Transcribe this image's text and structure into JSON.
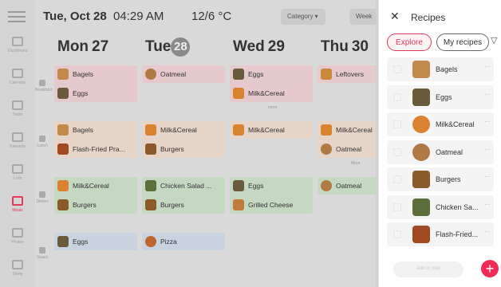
{
  "header": {
    "date": "Tue, Oct 28",
    "time": "04:29 AM",
    "weather": "12/6 °C",
    "category_label": "Category ▾",
    "week_label": "Week"
  },
  "rail": [
    {
      "icon": "dashboard-icon",
      "label": "Dashboard",
      "active": false
    },
    {
      "icon": "calendar-icon",
      "label": "Calendar",
      "active": false
    },
    {
      "icon": "tasks-icon",
      "label": "Tasks",
      "active": false
    },
    {
      "icon": "rewards-icon",
      "label": "Rewards",
      "active": false
    },
    {
      "icon": "lists-icon",
      "label": "Lists",
      "active": false
    },
    {
      "icon": "meals-icon",
      "label": "Meals",
      "active": true
    },
    {
      "icon": "photos-icon",
      "label": "Photos",
      "active": false
    },
    {
      "icon": "sleep-icon",
      "label": "Sleep",
      "active": false
    }
  ],
  "days": [
    {
      "name": "Mon",
      "num": "27",
      "today": false
    },
    {
      "name": "Tue",
      "num": "28",
      "today": true
    },
    {
      "name": "Wed",
      "num": "29",
      "today": false
    },
    {
      "name": "Thu",
      "num": "30",
      "today": false
    }
  ],
  "meal_bands": [
    {
      "label": "Breakfast",
      "color": "#e6c9cd",
      "cells": [
        [
          {
            "name": "Bagels",
            "thumb": "#c28a4a"
          },
          {
            "name": "Eggs",
            "thumb": "#6a5a3c"
          }
        ],
        [
          {
            "name": "Oatmeal",
            "thumb": "#b07a45"
          }
        ],
        [
          {
            "name": "Eggs",
            "thumb": "#6a5a3c"
          },
          {
            "name": "Milk&Cereal",
            "thumb": "#d9822f"
          }
        ],
        [
          {
            "name": "Leftovers",
            "thumb": "#c9893a"
          }
        ]
      ],
      "more": "more"
    },
    {
      "label": "Lunch",
      "color": "#e6d4c6",
      "cells": [
        [
          {
            "name": "Bagels",
            "thumb": "#c28a4a"
          },
          {
            "name": "Flash-Fried Pra...",
            "thumb": "#a14a22"
          }
        ],
        [
          {
            "name": "Milk&Cereal",
            "thumb": "#d9822f"
          },
          {
            "name": "Burgers",
            "thumb": "#8a5a2a"
          }
        ],
        [
          {
            "name": "Milk&Cereal",
            "thumb": "#d9822f"
          }
        ],
        [
          {
            "name": "Milk&Cereal",
            "thumb": "#d9822f"
          },
          {
            "name": "Oatmeal",
            "thumb": "#b07a45"
          }
        ]
      ],
      "more": "More"
    },
    {
      "label": "Dinner",
      "color": "#c5d9c2",
      "cells": [
        [
          {
            "name": "Milk&Cereal",
            "thumb": "#d9822f"
          },
          {
            "name": "Burgers",
            "thumb": "#8a5a2a"
          }
        ],
        [
          {
            "name": "Chicken Salad ...",
            "thumb": "#5c6e3a"
          },
          {
            "name": "Burgers",
            "thumb": "#8a5a2a"
          }
        ],
        [
          {
            "name": "Eggs",
            "thumb": "#6a5a3c"
          },
          {
            "name": "Grilled Cheese",
            "thumb": "#c07a3a"
          }
        ],
        [
          {
            "name": "Oatmeal",
            "thumb": "#b07a45"
          }
        ]
      ],
      "more": ""
    },
    {
      "label": "Snack",
      "color": "#c9d3df",
      "cells": [
        [
          {
            "name": "Eggs",
            "thumb": "#6a5a3c"
          }
        ],
        [
          {
            "name": "Pizza",
            "thumb": "#c0642e"
          }
        ],
        [],
        []
      ],
      "more": ""
    }
  ],
  "panel": {
    "close": "✕",
    "title": "Recipes",
    "tab_explore": "Explore",
    "tab_mine": "My recipes",
    "filter_icon": "▽",
    "recipes": [
      {
        "name": "Bagels",
        "thumb": "#c28a4a"
      },
      {
        "name": "Eggs",
        "thumb": "#6a5a3c"
      },
      {
        "name": "Milk&Cereal",
        "thumb": "#d9822f"
      },
      {
        "name": "Oatmeal",
        "thumb": "#b07a45"
      },
      {
        "name": "Burgers",
        "thumb": "#8a5a2a"
      },
      {
        "name": "Chicken Sa...",
        "thumb": "#5c6e3a"
      },
      {
        "name": "Flash-Fried...",
        "thumb": "#a14a22"
      }
    ],
    "add_plan": "Add to plan",
    "fab": "+"
  },
  "colors": {
    "accent": "#e23a5b",
    "fab": "#f12a56"
  }
}
